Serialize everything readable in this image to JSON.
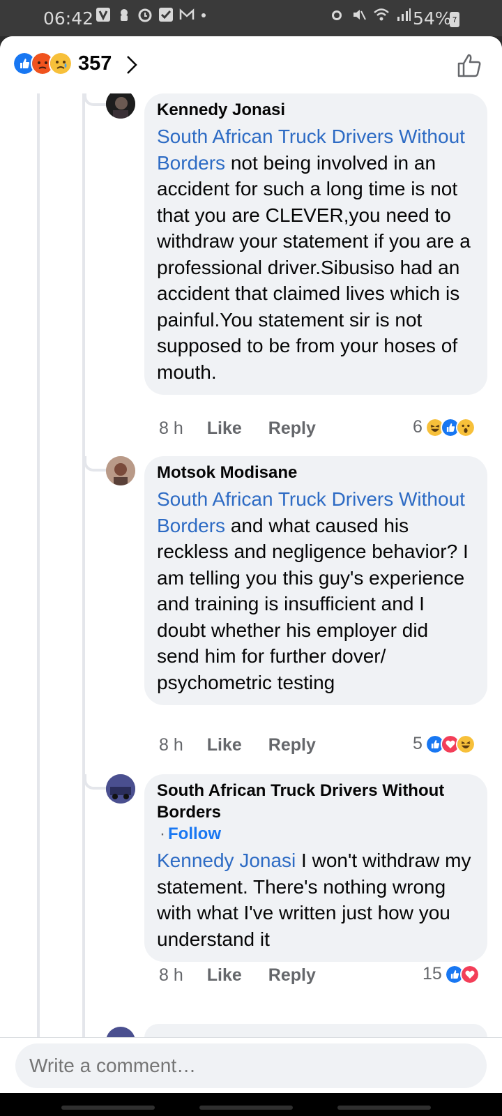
{
  "status_bar": {
    "time": "06:42",
    "battery": "54%",
    "battery_level": "7",
    "left_icons": [
      "v-app-icon",
      "game-icon",
      "alarm-icon",
      "check-icon",
      "mail-icon",
      "dot-icon"
    ],
    "right_icons": [
      "alarm-icon",
      "mute-icon",
      "wifi-icon",
      "signal-icon"
    ]
  },
  "header": {
    "reaction_count": "357",
    "reactions": [
      "like",
      "angry",
      "sad"
    ]
  },
  "comments": [
    {
      "author": "Kennedy Jonasi",
      "mention": "South African Truck Drivers Without Borders",
      "text": " not being involved in an accident for such a long time is not that you are CLEVER,you need to withdraw your statement if you are a professional driver.Sibusiso had an accident that claimed lives which is painful.You statement sir is not supposed to be from your hoses of mouth.",
      "time": "8 h",
      "like_label": "Like",
      "reply_label": "Reply",
      "reaction_count": "6",
      "reactions": [
        "haha",
        "like",
        "wow"
      ]
    },
    {
      "author": "Motsok Modisane",
      "mention": "South African Truck Drivers Without Borders",
      "text": " and what caused his reckless and negligence behavior? I am telling you this guy's experience and training is insufficient and I doubt whether his employer did send him for further dover/ psychometric testing",
      "time": "8 h",
      "like_label": "Like",
      "reply_label": "Reply",
      "reaction_count": "5",
      "reactions": [
        "like",
        "love",
        "haha"
      ]
    },
    {
      "author": "South African Truck Drivers Without Borders",
      "follow_label": "Follow",
      "mention": "Kennedy Jonasi",
      "text": " I won't withdraw my statement. There's nothing wrong with what I've written just how you understand it",
      "time": "8 h",
      "like_label": "Like",
      "reply_label": "Reply",
      "reaction_count": "15",
      "reactions": [
        "like",
        "love"
      ]
    }
  ],
  "composer": {
    "placeholder": "Write a comment…"
  },
  "colors": {
    "link": "#2d6bc4",
    "follow": "#1877f2",
    "bubble": "#f0f2f5",
    "meta": "#65676b"
  }
}
